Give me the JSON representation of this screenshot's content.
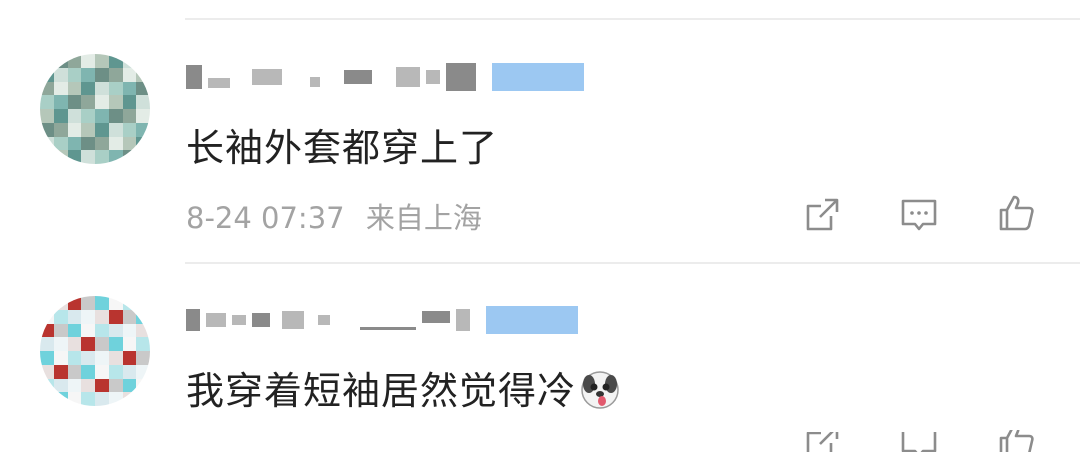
{
  "colors": {
    "text": "#222222",
    "meta": "#a3a3a3",
    "divider": "#ececec",
    "badge": "#9cc8f2",
    "icon": "#8c8c8c"
  },
  "comments": [
    {
      "text": "长袖外套都穿上了",
      "date": "8-24 07:37",
      "location": "来自上海",
      "actions": [
        "share-icon",
        "comment-icon",
        "like-icon"
      ]
    },
    {
      "text": "我穿着短袖居然觉得冷",
      "emoji": "dog-tongue-emoji",
      "actions": [
        "share-icon",
        "comment-icon",
        "like-icon"
      ]
    }
  ]
}
